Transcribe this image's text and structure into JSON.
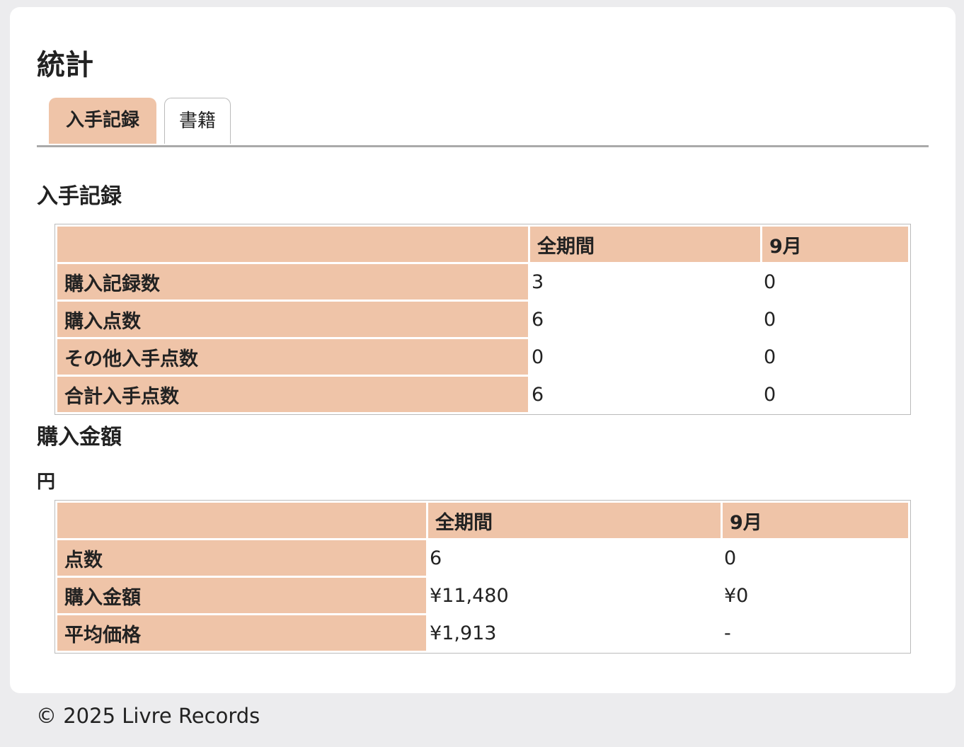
{
  "page": {
    "title": "統計"
  },
  "tabs": [
    {
      "label": "入手記録",
      "active": true
    },
    {
      "label": "書籍",
      "active": false
    }
  ],
  "acquisition": {
    "title": "入手記録",
    "headers": [
      "",
      "全期間",
      "9月"
    ],
    "rows": [
      {
        "label": "購入記録数",
        "all": "3",
        "month": "0"
      },
      {
        "label": "購入点数",
        "all": "6",
        "month": "0"
      },
      {
        "label": "その他入手点数",
        "all": "0",
        "month": "0"
      },
      {
        "label": "合計入手点数",
        "all": "6",
        "month": "0"
      }
    ]
  },
  "purchase": {
    "title": "購入金額",
    "unit": "円",
    "headers": [
      "",
      "全期間",
      "9月"
    ],
    "rows": [
      {
        "label": "点数",
        "all": "6",
        "month": "0"
      },
      {
        "label": "購入金額",
        "all": "¥11,480",
        "month": "¥0"
      },
      {
        "label": "平均価格",
        "all": "¥1,913",
        "month": "-"
      }
    ]
  },
  "footer": {
    "text": "© 2025 Livre Records"
  },
  "colors": {
    "accent": "#efc4a8",
    "background": "#ececee",
    "card": "#ffffff"
  }
}
